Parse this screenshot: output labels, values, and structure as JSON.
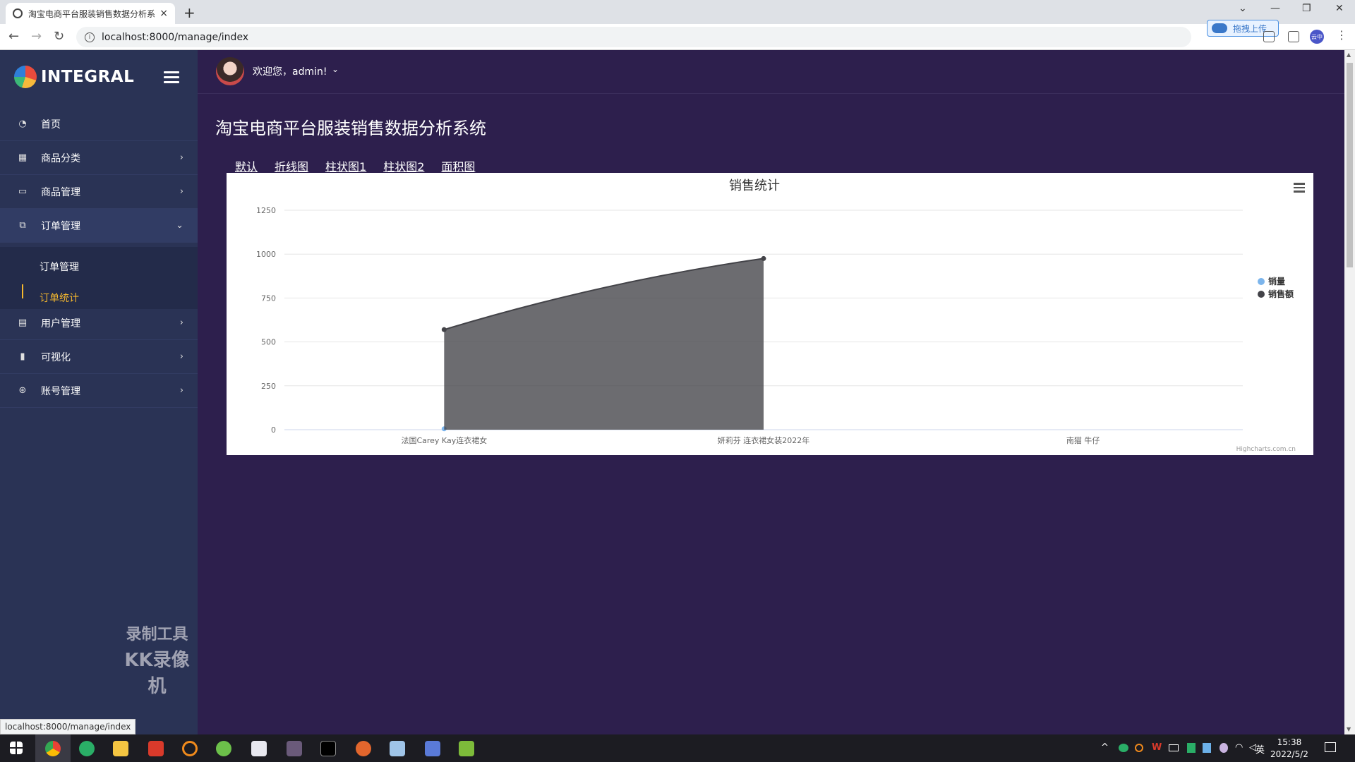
{
  "browser": {
    "tab_title": "淘宝电商平台服装销售数据分析系",
    "tab_close": "×",
    "new_tab": "+",
    "url": "localhost:8000/manage/index",
    "upload_label": "拖拽上传",
    "profile_label": "云中",
    "status_url": "localhost:8000/manage/index"
  },
  "sidebar": {
    "brand": "INTEGRAL",
    "items": [
      {
        "label": "首页",
        "icon": "dashboard-icon",
        "glyph": "◔",
        "chevron": ""
      },
      {
        "label": "商品分类",
        "icon": "grid-icon",
        "glyph": "▦",
        "chevron": "›"
      },
      {
        "label": "商品管理",
        "icon": "window-icon",
        "glyph": "▭",
        "chevron": "›"
      },
      {
        "label": "订单管理",
        "icon": "order-icon",
        "glyph": "⧉",
        "chevron": "⌄"
      },
      {
        "label": "用户管理",
        "icon": "document-icon",
        "glyph": "▤",
        "chevron": "›"
      },
      {
        "label": "可视化",
        "icon": "bar-chart-icon",
        "glyph": "▮",
        "chevron": "›"
      },
      {
        "label": "账号管理",
        "icon": "account-icon",
        "glyph": "⊛",
        "chevron": "›"
      }
    ],
    "submenu": [
      "订单管理",
      "订单统计"
    ],
    "watermark_line1": "录制工具",
    "watermark_line2": "KK录像机"
  },
  "header": {
    "welcome": "欢迎您，admin!",
    "dropdown": "⌄"
  },
  "main": {
    "title": "淘宝电商平台服装销售数据分析系统",
    "tabs": [
      "默认",
      "折线图",
      "柱状图1",
      "柱状图2",
      "面积图"
    ]
  },
  "chart_data": {
    "type": "area",
    "title": "销售统计",
    "categories": [
      "法国Carey Kay连衣裙女",
      "妍莉芬 连衣裙女装2022年",
      "南猫 牛仔"
    ],
    "series": [
      {
        "name": "销量",
        "color": "#7cb5ec",
        "values": [
          5,
          null,
          null
        ]
      },
      {
        "name": "销售额",
        "color": "#434348",
        "values": [
          570,
          975,
          null
        ]
      }
    ],
    "yticks": [
      0,
      250,
      500,
      750,
      1000,
      1250
    ],
    "ylim": [
      0,
      1250
    ],
    "ylabel": "",
    "legend": "right",
    "credit": "Highcharts.com.cn",
    "grid": true
  },
  "taskbar": {
    "time": "15:38",
    "date": "2022/5/2",
    "ime": "英"
  }
}
